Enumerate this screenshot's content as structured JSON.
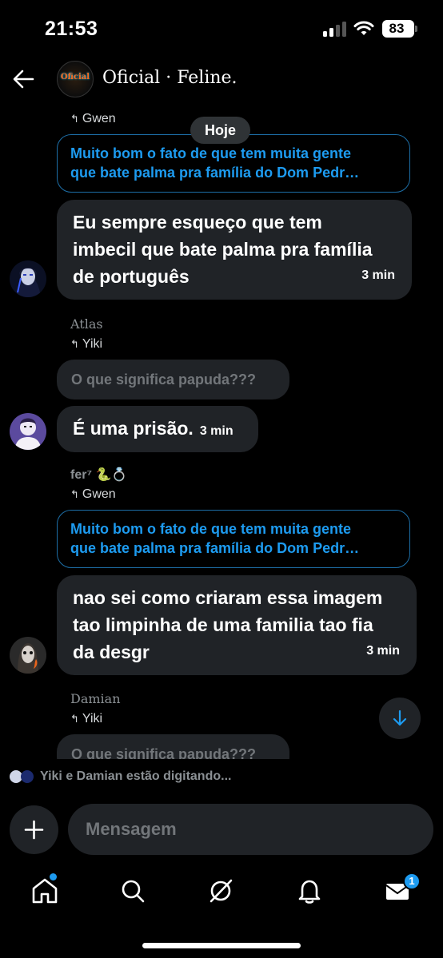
{
  "status_bar": {
    "time": "21:53",
    "battery": "83"
  },
  "header": {
    "title": "Oficial · Feline.",
    "avatar_text": "Oficial"
  },
  "date_separator": "Hoje",
  "messages": [
    {
      "reply_to": "Gwen",
      "quoted": [
        "Muito bom o fato de que tem muita gente",
        "que bate palma pra família do Dom Pedr…"
      ],
      "lines": [
        "Eu sempre esqueço que tem",
        "imbecil que bate palma pra família",
        "de português"
      ],
      "time": "3 min"
    },
    {
      "sender": "Atlas",
      "reply_to": "Yiki",
      "quoted": "O que significa papuda???",
      "text": "É uma prisão.",
      "time": "3 min"
    },
    {
      "sender": "fer⁷ 🐍💍",
      "reply_to": "Gwen",
      "quoted": [
        "Muito bom o fato de que tem muita gente",
        "que bate palma pra família do Dom Pedr…"
      ],
      "lines": [
        "nao sei como criaram essa imagem",
        "tao limpinha de uma familia tao fia",
        "da desgr"
      ],
      "time": "3 min"
    },
    {
      "sender": "Damian",
      "reply_to": "Yiki",
      "quoted": "O que significa papuda???"
    }
  ],
  "typing_indicator": "Yiki e Damian estão digitando...",
  "composer": {
    "placeholder": "Mensagem"
  },
  "tabbar": {
    "items": [
      "home-icon",
      "search-icon",
      "grok-icon",
      "bell-icon",
      "mail-icon"
    ],
    "mail_badge": "1"
  },
  "colors": {
    "accent": "#1d9bf0",
    "bubble": "#202327",
    "background": "#000000"
  }
}
